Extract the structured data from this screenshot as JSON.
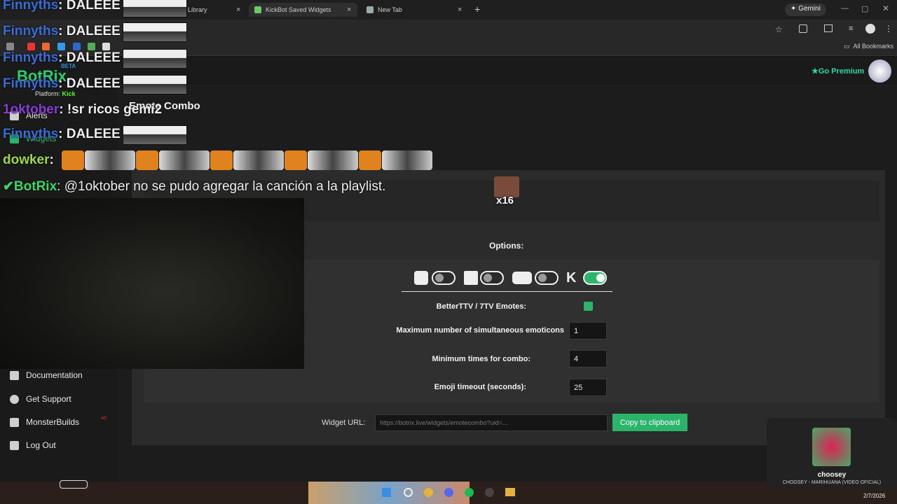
{
  "browser": {
    "tabs": [
      {
        "label": "t Library"
      },
      {
        "label": "KickBot Saved Widgets"
      },
      {
        "label": "New Tab"
      }
    ],
    "gemini_label": "Gemini",
    "bookmarks_label": "All Bookmarks"
  },
  "brand": {
    "name": "BotRix",
    "badge": "BETA"
  },
  "platform": {
    "label": "Platform:",
    "value": "Kick"
  },
  "header": {
    "premium_label": "Go Premium"
  },
  "sidebar": {
    "items": [
      {
        "label": "Alerts",
        "icon": "bell-icon"
      },
      {
        "label": "Widgets",
        "icon": "widgets-icon"
      },
      {
        "label": "Documentation",
        "icon": "book-icon"
      },
      {
        "label": "Get Support",
        "icon": "question-icon"
      },
      {
        "label": "MonsterBuilds",
        "icon": "laptop-icon"
      },
      {
        "label": "Log Out",
        "icon": "logout-icon"
      }
    ],
    "ad_badge": "AD"
  },
  "widget": {
    "title": "Emote Combo",
    "combo_label": "x16",
    "options_title": "Options:",
    "bttv_label": "BetterTTV / 7TV Emotes:",
    "max_label": "Maximum number of simultaneous emoticons",
    "max_value": "1",
    "min_label": "Minimum times for combo:",
    "min_value": "4",
    "timeout_label": "Emoji timeout (seconds):",
    "timeout_value": "25",
    "url_label": "Widget URL:",
    "url_value": "https://botrix.live/widgets/emotecombo?uid=...",
    "copy_label": "Copy to clipboard",
    "toggles": [
      {
        "platform": "kick-bot",
        "on": false
      },
      {
        "platform": "twitch",
        "on": false
      },
      {
        "platform": "youtube",
        "on": false
      },
      {
        "platform": "kick",
        "on": true
      }
    ]
  },
  "chat": [
    {
      "user": "Finnyths",
      "text": ": DALEEE",
      "color": "#3a6cd8"
    },
    {
      "user": "Finnyths",
      "text": ": DALEEE",
      "color": "#3a6cd8"
    },
    {
      "user": "Finnyths",
      "text": ": DALEEE",
      "color": "#3a6cd8"
    },
    {
      "user": "Finnyths",
      "text": ": DALEEE",
      "color": "#3a6cd8"
    },
    {
      "user": "1oktober",
      "text": ": !sr ricos gemi2",
      "color": "#8a3ad8"
    },
    {
      "user": "Finnyths",
      "text": ": DALEEE",
      "color": "#3a6cd8"
    },
    {
      "user": "dowker",
      "text": ":",
      "color": "#9ed84a"
    },
    {
      "user": "BotRix",
      "text": ": @1oktober no se pudo agregar la canción a la playlist.",
      "color": "#3ad86a"
    }
  ],
  "media_toast": {
    "artist": "choosey",
    "title": "CHOOSEY - MARIHUANA (VIDEO OFICIAL)"
  },
  "taskbar": {
    "date": "2/7/2026"
  }
}
